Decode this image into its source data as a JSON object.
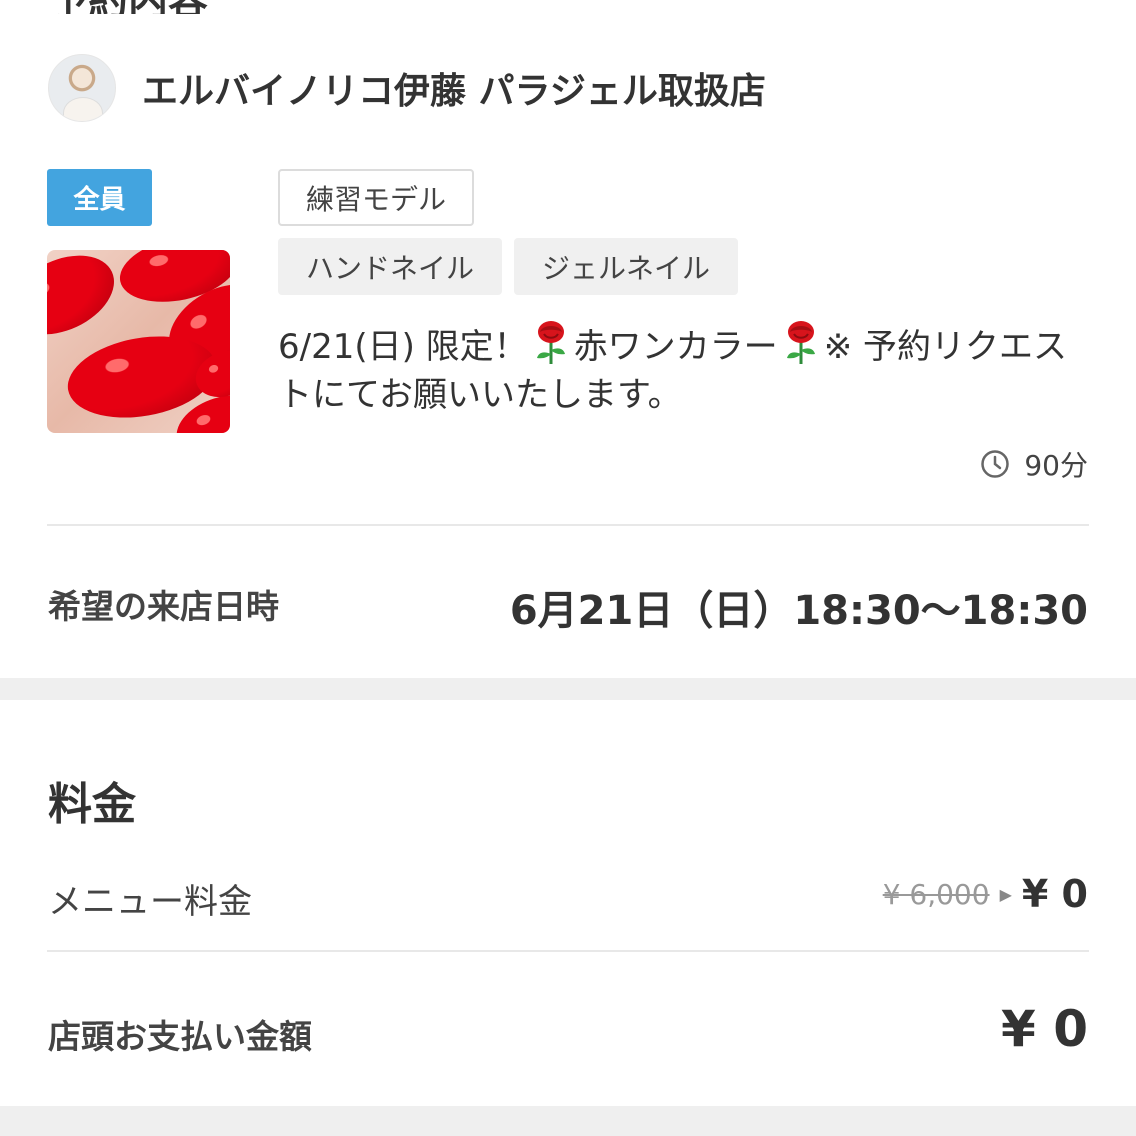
{
  "section_title_cut": "予約内容",
  "shop": {
    "name": "エルバイノリコ伊藤 パラジェル取扱店"
  },
  "badge": "全員",
  "tags": {
    "row1": [
      "練習モデル"
    ],
    "row2": [
      "ハンドネイル",
      "ジェルネイル"
    ]
  },
  "menu": {
    "desc_part1": "6/21(日) 限定！",
    "desc_part2": "赤ワンカラー",
    "desc_part3": "※ 予約リクエストにてお願いいたします。",
    "duration": "90分",
    "icons": [
      "rose-icon",
      "clock-icon"
    ]
  },
  "visit": {
    "label": "希望の来店日時",
    "value": "6月21日（日）18:30〜18:30"
  },
  "fee": {
    "title": "料金",
    "menu_label": "メニュー料金",
    "old_price": "¥ 6,000",
    "new_price": "¥ 0",
    "total_label": "店頭お支払い金額",
    "total_value": "¥ 0"
  },
  "colors": {
    "badge": "#43a4df",
    "text": "#333333",
    "divider": "#e8e8e8",
    "band": "#efefef"
  }
}
